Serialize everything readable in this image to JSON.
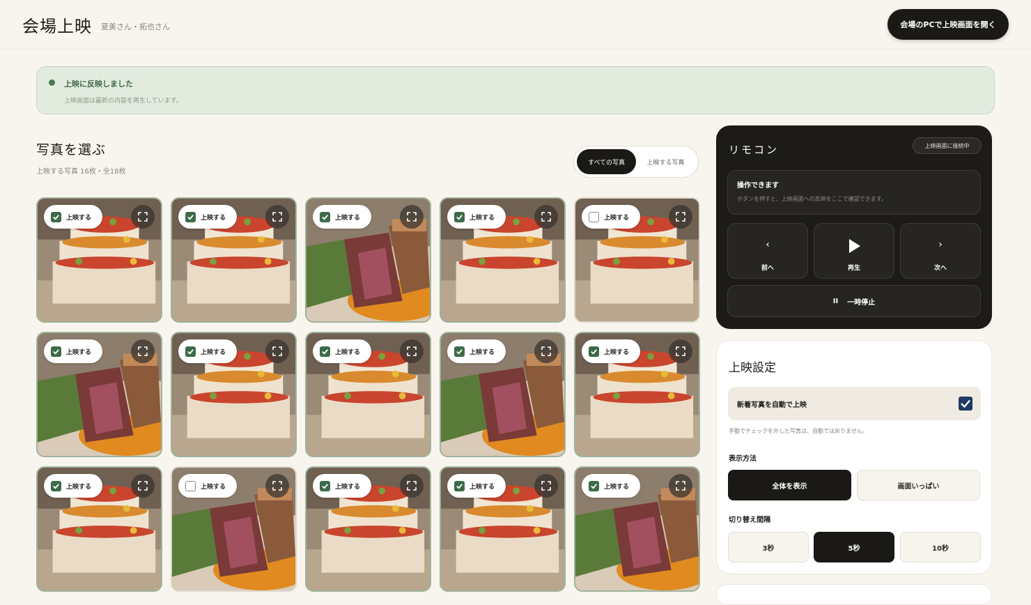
{
  "header": {
    "title": "会場上映",
    "couple": "夏美さん・拓也さん",
    "open_button": "会場のPCで上映画面を開く"
  },
  "banner": {
    "title": "上映に反映しました",
    "subtitle": "上映画面は最新の内容を再生しています。"
  },
  "photos_section": {
    "title": "写真を選ぶ",
    "subtitle": "上映する写真 16枚・全18枚",
    "filter_all": "すべての写真",
    "filter_selected": "上映する写真",
    "check_label": "上映する",
    "photos": [
      {
        "type": "cake",
        "selected": true
      },
      {
        "type": "cake",
        "selected": true
      },
      {
        "type": "steak",
        "selected": true
      },
      {
        "type": "cake",
        "selected": true
      },
      {
        "type": "cake",
        "selected": false
      },
      {
        "type": "steak",
        "selected": true
      },
      {
        "type": "cake",
        "selected": true
      },
      {
        "type": "cake",
        "selected": true
      },
      {
        "type": "steak",
        "selected": true
      },
      {
        "type": "cake",
        "selected": true
      },
      {
        "type": "cake",
        "selected": true
      },
      {
        "type": "steak",
        "selected": false
      },
      {
        "type": "cake",
        "selected": true
      },
      {
        "type": "cake",
        "selected": true
      },
      {
        "type": "steak",
        "selected": true
      }
    ]
  },
  "remote": {
    "title": "リモコン",
    "badge": "上映画面に接続中",
    "status_title": "操作できます",
    "status_sub": "ボタンを押すと、上映画面への反映をここで確認できます。",
    "prev": "前へ",
    "play": "再生",
    "next": "次へ",
    "pause": "一時停止"
  },
  "settings": {
    "title": "上映設定",
    "auto_label": "新着写真を自動で上映",
    "auto_checked": true,
    "note": "手動でチェックを外した写真は、自動では戻りません。",
    "display_label": "表示方法",
    "display_options": [
      "全体を表示",
      "画面いっぱい"
    ],
    "display_selected": "全体を表示",
    "interval_label": "切り替え間隔",
    "interval_options": [
      "3秒",
      "5秒",
      "10秒"
    ],
    "interval_selected": "5秒"
  },
  "colors": {
    "accent": "#1a1916",
    "success": "#3d6a48",
    "banner_bg": "#e3ebdf",
    "checkbox_blue": "#1f3a63"
  }
}
